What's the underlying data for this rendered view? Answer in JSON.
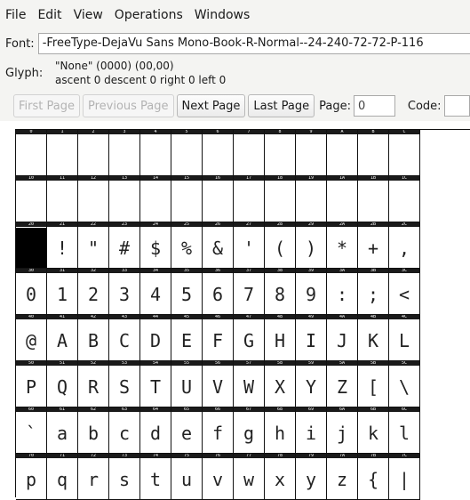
{
  "menubar": {
    "items": [
      {
        "label": "File"
      },
      {
        "label": "Edit"
      },
      {
        "label": "View"
      },
      {
        "label": "Operations"
      },
      {
        "label": "Windows"
      }
    ]
  },
  "font": {
    "label": "Font:",
    "value": "-FreeType-DejaVu Sans Mono-Book-R-Normal--24-240-72-72-P-116"
  },
  "glyph": {
    "label": "Glyph:",
    "line1": "\"None\" (0000) (00,00)",
    "line2": "ascent 0 descent 0 right 0 left 0"
  },
  "nav": {
    "first_page": "First Page",
    "previous_page": "Previous Page",
    "next_page": "Next Page",
    "last_page": "Last Page",
    "page_label": "Page:",
    "page_value": "0",
    "code_label": "Code:",
    "code_value": ""
  },
  "grid": {
    "rows": [
      {
        "codes": [
          "0",
          "1",
          "2",
          "3",
          "4",
          "5",
          "6",
          "7",
          "8",
          "9",
          "A",
          "B",
          "C"
        ],
        "glyphs": [
          "",
          "",
          "",
          "",
          "",
          "",
          "",
          "",
          "",
          "",
          "",
          "",
          ""
        ]
      },
      {
        "codes": [
          "10",
          "11",
          "12",
          "13",
          "14",
          "15",
          "16",
          "17",
          "18",
          "19",
          "1A",
          "1B",
          "1C"
        ],
        "glyphs": [
          "",
          "",
          "",
          "",
          "",
          "",
          "",
          "",
          "",
          "",
          "",
          "",
          ""
        ]
      },
      {
        "codes": [
          "20",
          "21",
          "22",
          "23",
          "24",
          "25",
          "26",
          "27",
          "28",
          "29",
          "2A",
          "2B",
          "2C"
        ],
        "glyphs": [
          "■",
          "!",
          "\"",
          "#",
          "$",
          "%",
          "&",
          "'",
          "(",
          ")",
          "*",
          "+",
          ","
        ]
      },
      {
        "codes": [
          "30",
          "31",
          "32",
          "33",
          "34",
          "35",
          "36",
          "37",
          "38",
          "39",
          "3A",
          "3B",
          "3C"
        ],
        "glyphs": [
          "0",
          "1",
          "2",
          "3",
          "4",
          "5",
          "6",
          "7",
          "8",
          "9",
          ":",
          ";",
          "<"
        ]
      },
      {
        "codes": [
          "40",
          "41",
          "42",
          "43",
          "44",
          "45",
          "46",
          "47",
          "48",
          "49",
          "4A",
          "4B",
          "4C"
        ],
        "glyphs": [
          "@",
          "A",
          "B",
          "C",
          "D",
          "E",
          "F",
          "G",
          "H",
          "I",
          "J",
          "K",
          "L"
        ]
      },
      {
        "codes": [
          "50",
          "51",
          "52",
          "53",
          "54",
          "55",
          "56",
          "57",
          "58",
          "59",
          "5A",
          "5B",
          "5C"
        ],
        "glyphs": [
          "P",
          "Q",
          "R",
          "S",
          "T",
          "U",
          "V",
          "W",
          "X",
          "Y",
          "Z",
          "[",
          "\\"
        ]
      },
      {
        "codes": [
          "60",
          "61",
          "62",
          "63",
          "64",
          "65",
          "66",
          "67",
          "68",
          "69",
          "6A",
          "6B",
          "6C"
        ],
        "glyphs": [
          "`",
          "a",
          "b",
          "c",
          "d",
          "e",
          "f",
          "g",
          "h",
          "i",
          "j",
          "k",
          "l"
        ]
      },
      {
        "codes": [
          "70",
          "71",
          "72",
          "73",
          "74",
          "75",
          "76",
          "77",
          "78",
          "79",
          "7A",
          "7B",
          "7C"
        ],
        "glyphs": [
          "p",
          "q",
          "r",
          "s",
          "t",
          "u",
          "v",
          "w",
          "x",
          "y",
          "z",
          "{",
          "|"
        ]
      }
    ],
    "selected_code": "20"
  }
}
